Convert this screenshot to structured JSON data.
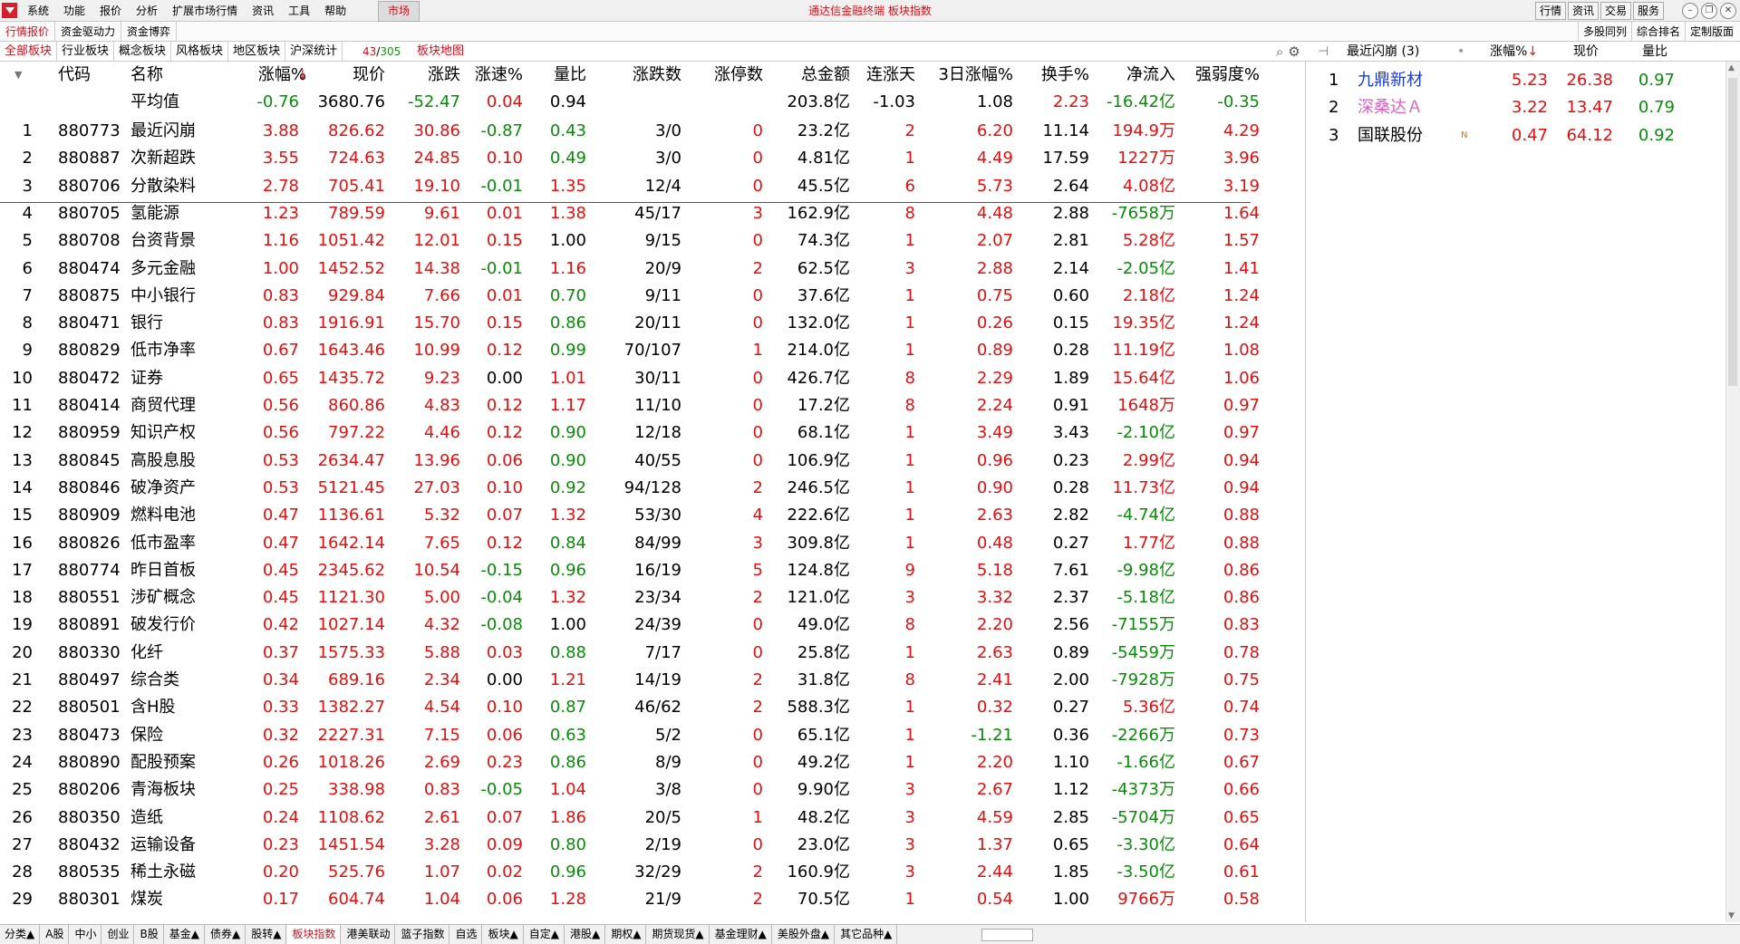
{
  "menubar": {
    "items": [
      "系统",
      "功能",
      "报价",
      "分析",
      "扩展市场行情",
      "资讯",
      "工具",
      "帮助"
    ],
    "market_tab": "市场",
    "app_title": "通达信金融终端  板块指数",
    "right_buttons": [
      "行情",
      "资讯",
      "交易",
      "服务"
    ]
  },
  "subbar": {
    "tabs": [
      "行情报价",
      "资金驱动力",
      "资金博弈"
    ],
    "right_tabs": [
      "多股同列",
      "综合排名",
      "定制版面"
    ]
  },
  "catbar": {
    "tabs": [
      "全部板块",
      "行业板块",
      "概念板块",
      "风格板块",
      "地区板块",
      "沪深统计"
    ],
    "count_a": "43",
    "count_sep": "/",
    "count_b": "305",
    "map_label": "板块地图"
  },
  "table": {
    "headers": [
      "代码",
      "名称",
      "涨幅%",
      "现价",
      "涨跌",
      "涨速%",
      "量比",
      "涨跌数",
      "涨停数",
      "总金额",
      "连涨天",
      "3日涨幅%",
      "换手%",
      "净流入",
      "强弱度%"
    ],
    "sort_arrow": "↓",
    "avg_row": {
      "label": "平均值",
      "cells": [
        "-0.76",
        "3680.76",
        "-52.47",
        "0.04",
        "0.94",
        "",
        "",
        "203.8亿",
        "-1.03",
        "1.08",
        "2.23",
        "-16.42亿",
        "-0.35"
      ]
    },
    "rows": [
      [
        "1",
        "880773",
        "最近闪崩",
        "3.88",
        "826.62",
        "30.86",
        "-0.87",
        "0.43",
        "3/0",
        "0",
        "23.2亿",
        "2",
        "6.20",
        "11.14",
        "194.9万",
        "4.29"
      ],
      [
        "2",
        "880887",
        "次新超跌",
        "3.55",
        "724.63",
        "24.85",
        "0.10",
        "0.49",
        "3/0",
        "0",
        "4.81亿",
        "1",
        "4.49",
        "17.59",
        "1227万",
        "3.96"
      ],
      [
        "3",
        "880706",
        "分散染料",
        "2.78",
        "705.41",
        "19.10",
        "-0.01",
        "1.35",
        "12/4",
        "0",
        "45.5亿",
        "6",
        "5.73",
        "2.64",
        "4.08亿",
        "3.19"
      ],
      [
        "4",
        "880705",
        "氢能源",
        "1.23",
        "789.59",
        "9.61",
        "0.01",
        "1.38",
        "45/17",
        "3",
        "162.9亿",
        "8",
        "4.48",
        "2.88",
        "-7658万",
        "1.64"
      ],
      [
        "5",
        "880708",
        "台资背景",
        "1.16",
        "1051.42",
        "12.01",
        "0.15",
        "1.00",
        "9/15",
        "0",
        "74.3亿",
        "1",
        "2.07",
        "2.81",
        "5.28亿",
        "1.57"
      ],
      [
        "6",
        "880474",
        "多元金融",
        "1.00",
        "1452.52",
        "14.38",
        "-0.01",
        "1.16",
        "20/9",
        "2",
        "62.5亿",
        "3",
        "2.88",
        "2.14",
        "-2.05亿",
        "1.41"
      ],
      [
        "7",
        "880875",
        "中小银行",
        "0.83",
        "929.84",
        "7.66",
        "0.01",
        "0.70",
        "9/11",
        "0",
        "37.6亿",
        "1",
        "0.75",
        "0.60",
        "2.18亿",
        "1.24"
      ],
      [
        "8",
        "880471",
        "银行",
        "0.83",
        "1916.91",
        "15.70",
        "0.15",
        "0.86",
        "20/11",
        "0",
        "132.0亿",
        "1",
        "0.26",
        "0.15",
        "19.35亿",
        "1.24"
      ],
      [
        "9",
        "880829",
        "低市净率",
        "0.67",
        "1643.46",
        "10.99",
        "0.12",
        "0.99",
        "70/107",
        "1",
        "214.0亿",
        "1",
        "0.89",
        "0.28",
        "11.19亿",
        "1.08"
      ],
      [
        "10",
        "880472",
        "证券",
        "0.65",
        "1435.72",
        "9.23",
        "0.00",
        "1.01",
        "30/11",
        "0",
        "426.7亿",
        "8",
        "2.29",
        "1.89",
        "15.64亿",
        "1.06"
      ],
      [
        "11",
        "880414",
        "商贸代理",
        "0.56",
        "860.86",
        "4.83",
        "0.12",
        "1.17",
        "11/10",
        "0",
        "17.2亿",
        "8",
        "2.24",
        "0.91",
        "1648万",
        "0.97"
      ],
      [
        "12",
        "880959",
        "知识产权",
        "0.56",
        "797.22",
        "4.46",
        "0.12",
        "0.90",
        "12/18",
        "0",
        "68.1亿",
        "1",
        "3.49",
        "3.43",
        "-2.10亿",
        "0.97"
      ],
      [
        "13",
        "880845",
        "高股息股",
        "0.53",
        "2634.47",
        "13.96",
        "0.06",
        "0.90",
        "40/55",
        "0",
        "106.9亿",
        "1",
        "0.96",
        "0.23",
        "2.99亿",
        "0.94"
      ],
      [
        "14",
        "880846",
        "破净资产",
        "0.53",
        "5121.45",
        "27.03",
        "0.10",
        "0.92",
        "94/128",
        "2",
        "246.5亿",
        "1",
        "0.90",
        "0.28",
        "11.73亿",
        "0.94"
      ],
      [
        "15",
        "880909",
        "燃料电池",
        "0.47",
        "1136.61",
        "5.32",
        "0.07",
        "1.32",
        "53/30",
        "4",
        "222.6亿",
        "1",
        "2.63",
        "2.82",
        "-4.74亿",
        "0.88"
      ],
      [
        "16",
        "880826",
        "低市盈率",
        "0.47",
        "1642.14",
        "7.65",
        "0.12",
        "0.84",
        "84/99",
        "3",
        "309.8亿",
        "1",
        "0.48",
        "0.27",
        "1.77亿",
        "0.88"
      ],
      [
        "17",
        "880774",
        "昨日首板",
        "0.45",
        "2345.62",
        "10.54",
        "-0.15",
        "0.96",
        "16/19",
        "5",
        "124.8亿",
        "9",
        "5.18",
        "7.61",
        "-9.98亿",
        "0.86"
      ],
      [
        "18",
        "880551",
        "涉矿概念",
        "0.45",
        "1121.30",
        "5.00",
        "-0.04",
        "1.32",
        "23/34",
        "2",
        "121.0亿",
        "3",
        "3.32",
        "2.37",
        "-5.18亿",
        "0.86"
      ],
      [
        "19",
        "880891",
        "破发行价",
        "0.42",
        "1027.14",
        "4.32",
        "-0.08",
        "1.00",
        "24/39",
        "0",
        "49.0亿",
        "8",
        "2.20",
        "2.56",
        "-7155万",
        "0.83"
      ],
      [
        "20",
        "880330",
        "化纤",
        "0.37",
        "1575.33",
        "5.88",
        "0.03",
        "0.88",
        "7/17",
        "0",
        "25.8亿",
        "1",
        "2.63",
        "0.89",
        "-5459万",
        "0.78"
      ],
      [
        "21",
        "880497",
        "综合类",
        "0.34",
        "689.16",
        "2.34",
        "0.00",
        "1.21",
        "14/19",
        "2",
        "31.8亿",
        "8",
        "2.41",
        "2.00",
        "-7928万",
        "0.75"
      ],
      [
        "22",
        "880501",
        "含H股",
        "0.33",
        "1382.27",
        "4.54",
        "0.10",
        "0.87",
        "46/62",
        "2",
        "588.3亿",
        "1",
        "0.32",
        "0.27",
        "5.36亿",
        "0.74"
      ],
      [
        "23",
        "880473",
        "保险",
        "0.32",
        "2227.31",
        "7.15",
        "0.06",
        "0.63",
        "5/2",
        "0",
        "65.1亿",
        "1",
        "-1.21",
        "0.36",
        "-2266万",
        "0.73"
      ],
      [
        "24",
        "880890",
        "配股预案",
        "0.26",
        "1018.26",
        "2.69",
        "0.23",
        "0.86",
        "8/9",
        "0",
        "49.2亿",
        "1",
        "2.20",
        "1.10",
        "-1.66亿",
        "0.67"
      ],
      [
        "25",
        "880206",
        "青海板块",
        "0.25",
        "338.98",
        "0.83",
        "-0.05",
        "1.04",
        "3/8",
        "0",
        "9.90亿",
        "3",
        "2.67",
        "1.12",
        "-4373万",
        "0.66"
      ],
      [
        "26",
        "880350",
        "造纸",
        "0.24",
        "1108.62",
        "2.61",
        "0.07",
        "1.86",
        "20/5",
        "1",
        "48.2亿",
        "3",
        "4.59",
        "2.85",
        "-5704万",
        "0.65"
      ],
      [
        "27",
        "880432",
        "运输设备",
        "0.23",
        "1451.54",
        "3.28",
        "0.09",
        "0.80",
        "2/19",
        "0",
        "23.0亿",
        "3",
        "1.37",
        "0.65",
        "-3.30亿",
        "0.64"
      ],
      [
        "28",
        "880535",
        "稀土永磁",
        "0.20",
        "525.76",
        "1.07",
        "0.02",
        "0.96",
        "32/29",
        "2",
        "160.9亿",
        "3",
        "2.44",
        "1.85",
        "-3.50亿",
        "0.61"
      ],
      [
        "29",
        "880301",
        "煤炭",
        "0.17",
        "604.74",
        "1.04",
        "0.06",
        "1.28",
        "21/9",
        "2",
        "70.5亿",
        "1",
        "0.54",
        "1.00",
        "9766万",
        "0.58"
      ]
    ]
  },
  "right_panel": {
    "title": "最近闪崩 (3)",
    "headers": [
      "涨幅%",
      "现价",
      "量比"
    ],
    "sort_arrow": "↓",
    "rows": [
      {
        "idx": "1",
        "name": "九鼎新材",
        "flag": "",
        "pct": "5.23",
        "price": "26.38",
        "ratio": "0.97",
        "name_color": "#1a3ad0"
      },
      {
        "idx": "2",
        "name": "深桑达Ａ",
        "flag": "",
        "pct": "3.22",
        "price": "13.47",
        "ratio": "0.79",
        "name_color": "#e060c0"
      },
      {
        "idx": "3",
        "name": "国联股份",
        "flag": "N",
        "pct": "0.47",
        "price": "64.12",
        "ratio": "0.92",
        "name_color": "#000000"
      }
    ]
  },
  "bottombar": {
    "tabs": [
      "分类▲",
      "A股",
      "中小",
      "创业",
      "B股",
      "基金▲",
      "债券▲",
      "股转▲",
      "板块指数",
      "港美联动",
      "篮子指数",
      "自选",
      "板块▲",
      "自定▲",
      "港股▲",
      "期权▲",
      "期货现货▲",
      "基金理财▲",
      "美股外盘▲",
      "其它品种▲"
    ],
    "active_index": 8
  },
  "colors": {
    "up": "#e01010",
    "down": "#0a8a0a",
    "accent": "#d0101c"
  }
}
